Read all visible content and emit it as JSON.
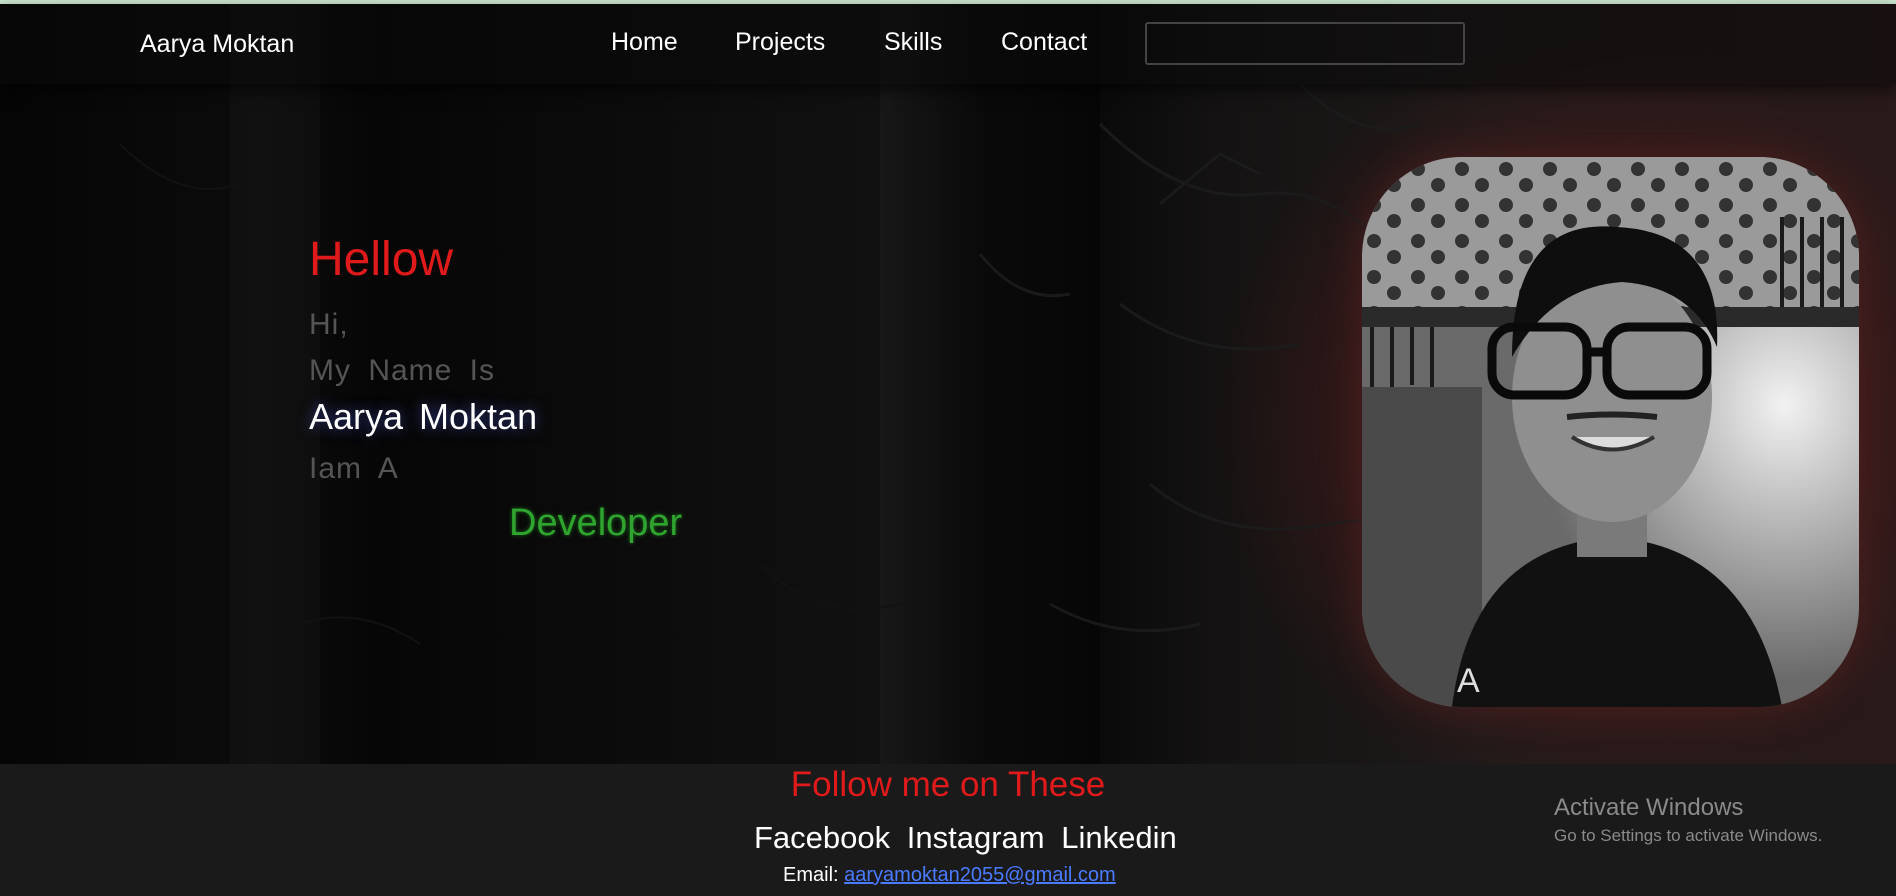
{
  "navbar": {
    "brand": "Aarya Moktan",
    "links": [
      "Home",
      "Projects",
      "Skills",
      "Contact"
    ],
    "search_value": ""
  },
  "hero": {
    "greeting": "Hellow",
    "hi": "Hi,",
    "intro": "My Name Is",
    "name": "Aarya Moktan",
    "iam": "Iam A",
    "role": "Developer"
  },
  "footer": {
    "follow_title": "Follow me on These",
    "socials": [
      "Facebook",
      "Instagram",
      "Linkedin"
    ],
    "email_label": "Email:",
    "email": "aaryamoktan2055@gmail.com"
  },
  "watermark": {
    "title": "Activate Windows",
    "subtitle": "Go to Settings to activate Windows."
  },
  "colors": {
    "accent_red": "#e01a1a",
    "accent_green": "#2fa52f",
    "link_blue": "#4a7bff",
    "footer_bg": "#1b1a1b"
  }
}
